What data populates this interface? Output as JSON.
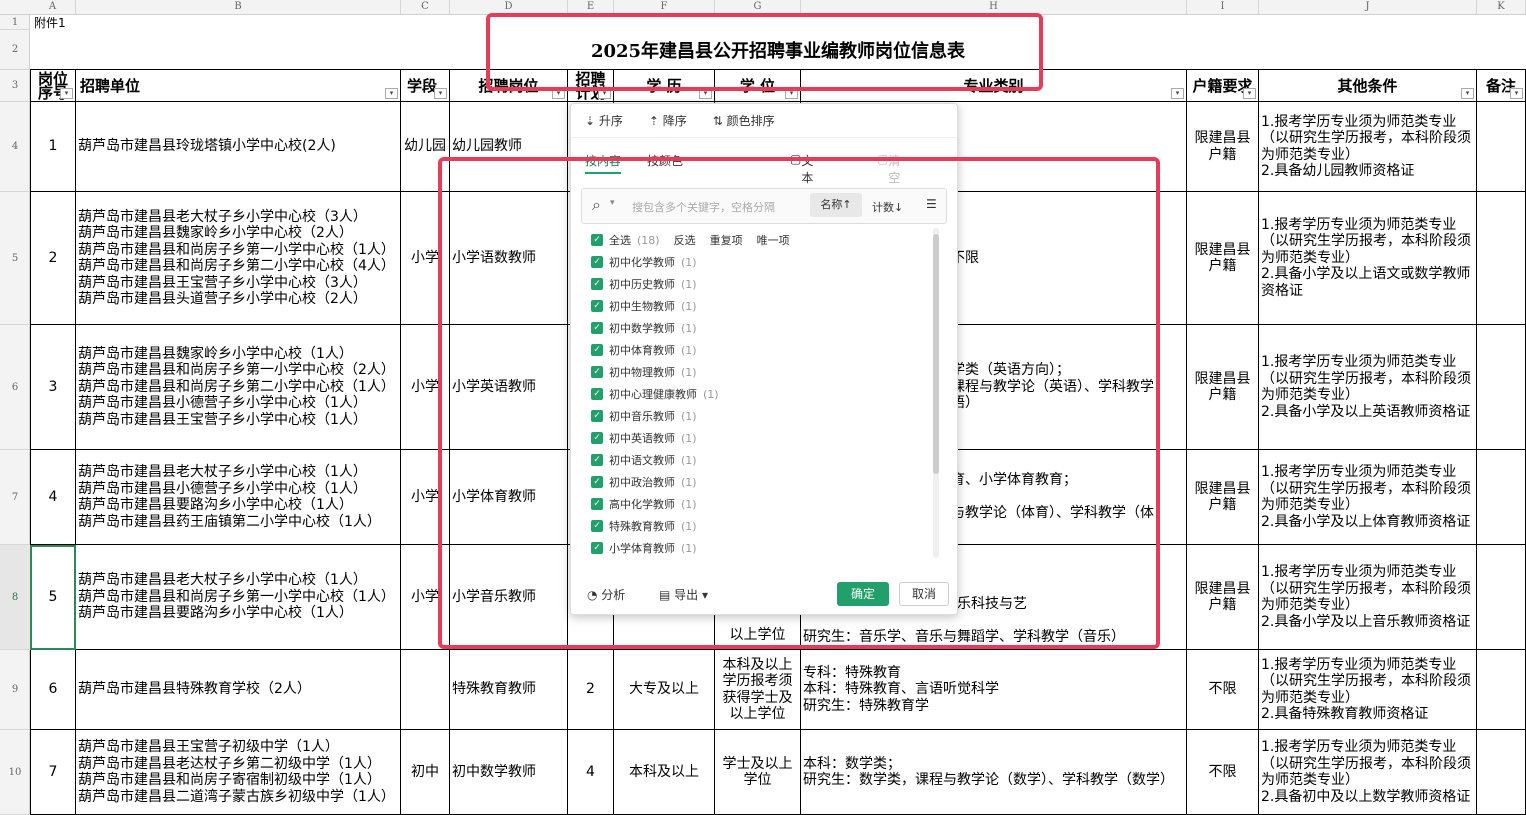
{
  "columns": [
    "A",
    "B",
    "C",
    "D",
    "E",
    "F",
    "G",
    "H",
    "I",
    "J",
    "K"
  ],
  "rows": [
    "1",
    "2",
    "3",
    "4",
    "5",
    "6",
    "7",
    "8",
    "9",
    "10"
  ],
  "a1_note": "附件1",
  "title": "2025年建昌县公开招聘事业编教师岗位信息表",
  "headers": {
    "a": "岗位序号",
    "b": "招聘单位",
    "c": "学段",
    "d": "招聘岗位",
    "e": "招聘计划",
    "f": "学 历",
    "g": "学 位",
    "h": "专业类别",
    "i": "户籍要求",
    "j": "其他条件",
    "k": "备注"
  },
  "data_rows": [
    {
      "no": "1",
      "units": "葫芦岛市建昌县玲珑塔镇小学中心校(2人)",
      "stage": "幼儿园",
      "post": "幼儿园教师",
      "plan": "",
      "edu": "",
      "degree": "",
      "major": "",
      "hukou": "限建昌县\n户籍",
      "other": "1.报考学历专业须为师范类专业\n（以研究生学历报考，本科阶段须\n为师范类专业）\n2.具备幼儿园教师资格证"
    },
    {
      "no": "2",
      "units": "葫芦岛市建昌县老大杖子乡小学中心校（3人）\n葫芦岛市建昌县魏家岭乡小学中心校（2人）\n葫芦岛市建昌县和尚房子乡第一小学中心校（1人）\n葫芦岛市建昌县和尚房子乡第二小学中心校（4人）\n葫芦岛市建昌县王宝营子乡小学中心校（3人）\n葫芦岛市建昌县头道营子乡小学中心校（2人）",
      "stage": "小学",
      "post": "小学语数教师",
      "plan": "",
      "edu": "",
      "degree": "",
      "major": "不限",
      "hukou": "限建昌县\n户籍",
      "other": "1.报考学历专业须为师范类专业\n（以研究生学历报考，本科阶段须\n为师范类专业）\n2.具备小学及以上语文或数学教师\n资格证"
    },
    {
      "no": "3",
      "units": "葫芦岛市建昌县魏家岭乡小学中心校（1人）\n葫芦岛市建昌县和尚房子乡第一小学中心校（2人）\n葫芦岛市建昌县和尚房子乡第二小学中心校（1人）\n葫芦岛市建昌县小德营子乡小学中心校（1人）\n葫芦岛市建昌县王宝营子乡小学中心校（1人）",
      "stage": "小学",
      "post": "小学英语教师",
      "plan": "",
      "edu": "",
      "degree": "",
      "major": "学类（英语方向）；\n课程与教学论（英语）、学科教学\n语）",
      "hukou": "限建昌县\n户籍",
      "other": "1.报考学历专业须为师范类专业\n（以研究生学历报考，本科阶段须\n为师范类专业）\n2.具备小学及以上英语教师资格证"
    },
    {
      "no": "4",
      "units": "葫芦岛市建昌县老大杖子乡小学中心校（1人）\n葫芦岛市建昌县小德营子乡小学中心校（1人）\n葫芦岛市建昌县要路沟乡小学中心校（1人）\n葫芦岛市建昌县药王庙镇第二小学中心校（1人）",
      "stage": "小学",
      "post": "小学体育教师",
      "plan": "",
      "edu": "",
      "degree": "",
      "major": "育、小学体育教育；\n\n与教学论（体育）、学科教学（体",
      "hukou": "限建昌县\n户籍",
      "other": "1.报考学历专业须为师范类专业\n（以研究生学历报考，本科阶段须\n为师范类专业）\n2.具备小学及以上体育教师资格证"
    },
    {
      "no": "5",
      "units": "葫芦岛市建昌县老大杖子乡小学中心校（1人）\n葫芦岛市建昌县和尚房子乡第一小学中心校（1人）\n葫芦岛市建昌县要路沟乡小学中心校（1人）",
      "stage": "小学",
      "post": "小学音乐教师",
      "plan": "",
      "edu": "",
      "degree": "以上学位",
      "major": "音乐教育、音乐表演、音乐科技与艺\n\n研究生：音乐学、音乐与舞蹈学、学科教学（音乐）",
      "hukou": "限建昌县\n户籍",
      "other": "1.报考学历专业须为师范类专业\n（以研究生学历报考，本科阶段须\n为师范类专业）\n2.具备小学及以上音乐教师资格证"
    },
    {
      "no": "6",
      "units": "葫芦岛市建昌县特殊教育学校（2人）",
      "stage": "",
      "post": "特殊教育教师",
      "plan": "2",
      "edu": "大专及以上",
      "degree": "本科及以上\n学历报考须\n获得学士及\n以上学位",
      "major": "专科：特殊教育\n本科：特殊教育、言语听觉科学\n研究生：特殊教育学",
      "hukou": "不限",
      "other": "1.报考学历专业须为师范类专业\n（以研究生学历报考，本科阶段须\n为师范类专业）\n2.具备特殊教育教师资格证"
    },
    {
      "no": "7",
      "units": "葫芦岛市建昌县王宝营子初级中学（1人）\n葫芦岛市建昌县老达杖子乡第二初级中学（1人）\n葫芦岛市建昌县和尚房子寄宿制初级中学（1人）\n葫芦岛市建昌县二道湾子蒙古族乡初级中学（1人）",
      "stage": "初中",
      "post": "初中数学教师",
      "plan": "4",
      "edu": "本科及以上",
      "degree": "学士及以上\n学位",
      "major": "本科：数学类；\n研究生：数学类，课程与教学论（数学）、学科教学（数学）",
      "hukou": "不限",
      "other": "1.报考学历专业须为师范类专业\n（以研究生学历报考，本科阶段须\n为师范类专业）\n2.具备初中及以上数学教师资格证"
    }
  ],
  "filter": {
    "sort_asc": "升序",
    "sort_desc": "降序",
    "sort_color": "颜色排序",
    "tab_content": "按内容",
    "tab_color": "按颜色",
    "text_filter": "文本筛选",
    "clear_filter": "清空条件",
    "search_placeholder": "搜包含多个关键字，空格分隔",
    "sort_name": "名称↑",
    "sort_count": "计数↓",
    "select_all": "全选",
    "select_all_count": "(18)",
    "invert": "反选",
    "duplicates": "重复项",
    "unique": "唯一项",
    "items": [
      {
        "label": "初中化学教师",
        "count": "(1)"
      },
      {
        "label": "初中历史教师",
        "count": "(1)"
      },
      {
        "label": "初中生物教师",
        "count": "(1)"
      },
      {
        "label": "初中数学教师",
        "count": "(1)"
      },
      {
        "label": "初中体育教师",
        "count": "(1)"
      },
      {
        "label": "初中物理教师",
        "count": "(1)"
      },
      {
        "label": "初中心理健康教师",
        "count": "(1)"
      },
      {
        "label": "初中音乐教师",
        "count": "(1)"
      },
      {
        "label": "初中英语教师",
        "count": "(1)"
      },
      {
        "label": "初中语文教师",
        "count": "(1)"
      },
      {
        "label": "初中政治教师",
        "count": "(1)"
      },
      {
        "label": "高中化学教师",
        "count": "(1)"
      },
      {
        "label": "特殊教育教师",
        "count": "(1)"
      },
      {
        "label": "小学体育教师",
        "count": "(1)"
      }
    ],
    "analyze": "分析",
    "export": "导出",
    "confirm": "确定",
    "cancel": "取消"
  },
  "colors": {
    "accent": "#22a06b",
    "highlight_box": "#e63c5a"
  }
}
